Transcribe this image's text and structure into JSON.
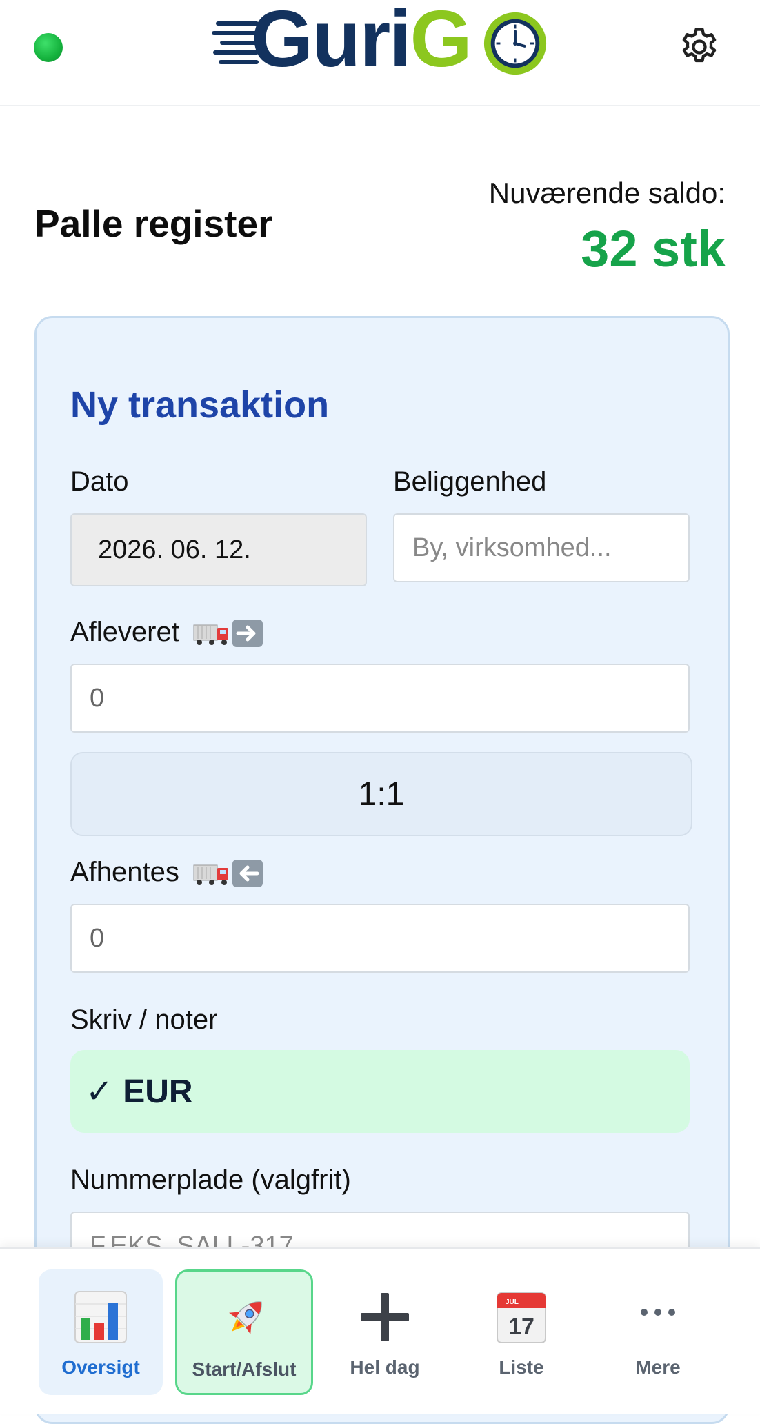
{
  "header": {
    "logo_text_a": "Guri",
    "logo_text_b": "G",
    "status": "online",
    "status_color": "#16b23d",
    "settings_icon": "gear-icon"
  },
  "page": {
    "title": "Palle register",
    "saldo_label": "Nuværende saldo:",
    "saldo_value": "32 stk",
    "saldo_color": "#16a34a"
  },
  "form": {
    "card_title": "Ny transaktion",
    "dato_label": "Dato",
    "dato_value": "2026. 06. 12.",
    "beliggenhed_label": "Beliggenhed",
    "beliggenhed_placeholder": "By, virksomhed...",
    "afleveret_label": "Afleveret",
    "afleveret_value": "0",
    "ratio_label": "1:1",
    "afhentes_label": "Afhentes",
    "afhentes_value": "0",
    "noter_label": "Skriv / noter",
    "noter_check": "✓",
    "noter_value": "EUR",
    "nummerplade_label": "Nummerplade (valgfrit)",
    "nummerplade_placeholder": "F.EKS. SALL-317"
  },
  "nav": {
    "items": [
      {
        "label": "Oversigt",
        "icon": "bar-chart-icon",
        "active": true
      },
      {
        "label": "Start/Afslut",
        "icon": "rocket-icon"
      },
      {
        "label": "Hel dag",
        "icon": "plus-icon"
      },
      {
        "label": "Liste",
        "icon": "calendar-icon",
        "calendar_month": "JUL",
        "calendar_day": "17"
      },
      {
        "label": "Mere",
        "icon": "more-icon"
      }
    ]
  }
}
